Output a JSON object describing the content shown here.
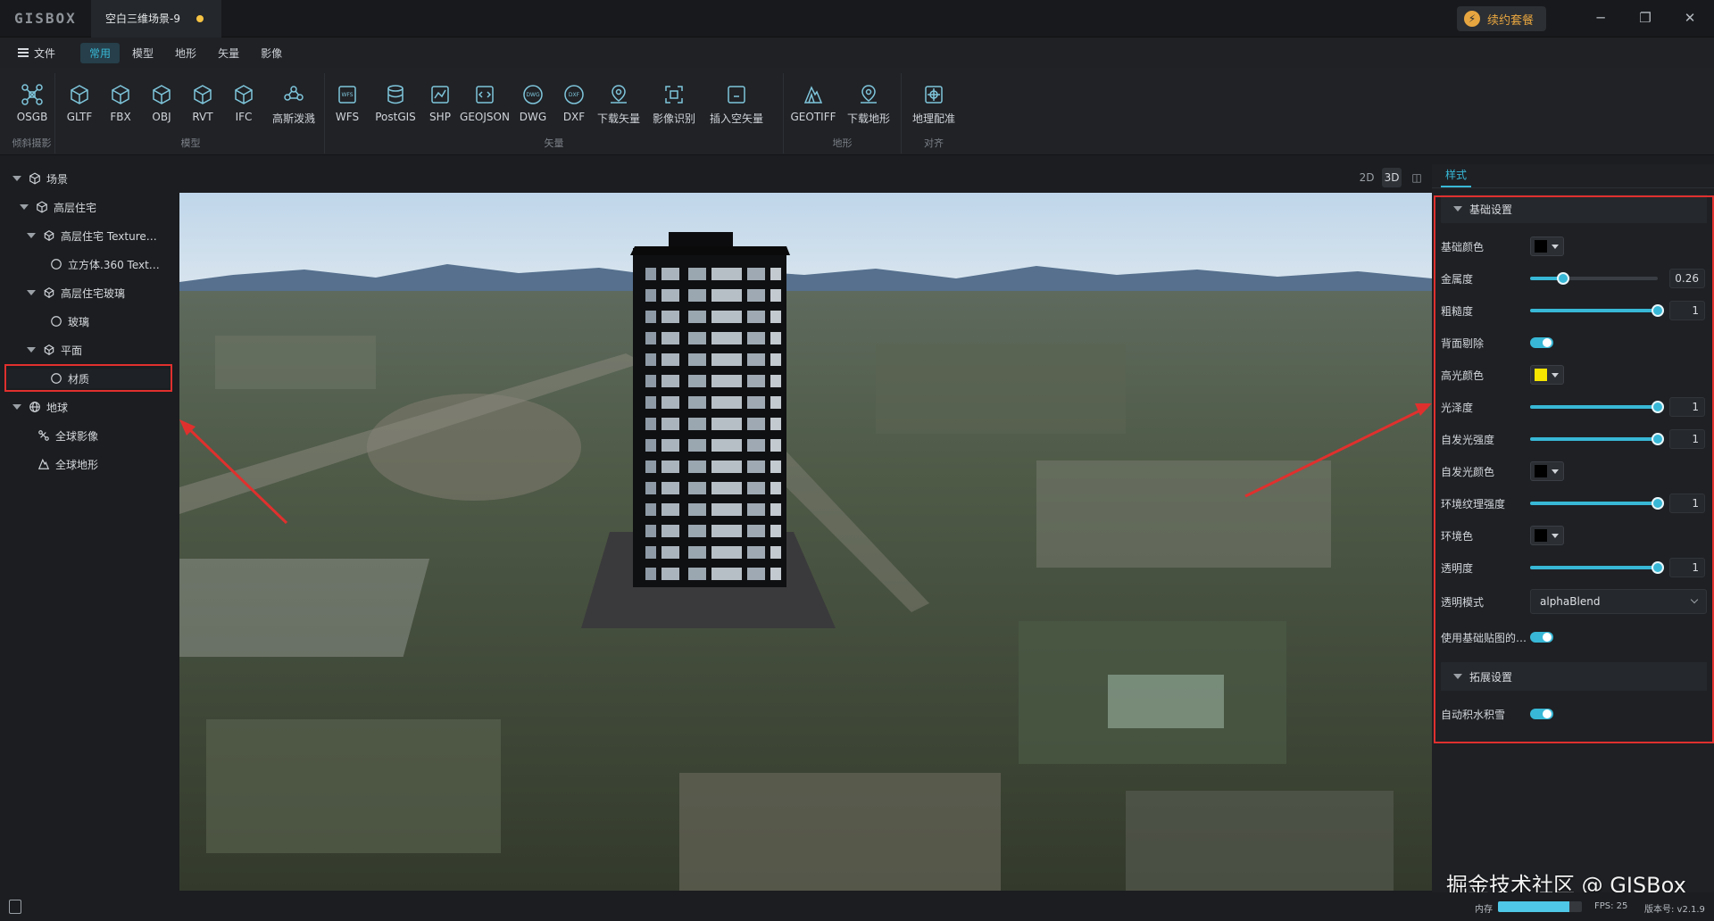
{
  "app": {
    "logo": "GISBOX",
    "doc_title": "空白三维场景-9",
    "renew_label": "续约套餐"
  },
  "window_buttons": {
    "minimize": "─",
    "restore": "❐",
    "close": "✕"
  },
  "menu": {
    "file": "文件",
    "tabs": [
      "常用",
      "模型",
      "地形",
      "矢量",
      "影像"
    ],
    "active_tab": "常用"
  },
  "ribbon": {
    "groups": [
      {
        "title": "倾斜摄影",
        "tools": [
          "OSGB"
        ]
      },
      {
        "title": "模型",
        "tools": [
          "GLTF",
          "FBX",
          "OBJ",
          "RVT",
          "IFC",
          "高斯泼溅"
        ]
      },
      {
        "title": "矢量",
        "tools": [
          "WFS",
          "PostGIS",
          "SHP",
          "GEOJSON",
          "DWG",
          "DXF",
          "下载矢量",
          "影像识别",
          "插入空矢量"
        ]
      },
      {
        "title": "地形",
        "tools": [
          "GEOTIFF",
          "下载地形"
        ]
      },
      {
        "title": "对齐",
        "tools": [
          "地理配准"
        ]
      }
    ]
  },
  "tree": {
    "scene": "场景",
    "building": "高层住宅",
    "building_texture": "高层住宅 Texture…",
    "cube": "立方体.360 Text…",
    "glass_group": "高层住宅玻璃",
    "glass": "玻璃",
    "plane": "平面",
    "material": "材质",
    "earth": "地球",
    "global_imagery": "全球影像",
    "global_terrain": "全球地形"
  },
  "view_modes": [
    "2D",
    "3D",
    "◫"
  ],
  "style_panel": {
    "tab": "样式",
    "basic_section": "基础设置",
    "ext_section": "拓展设置",
    "base_color": {
      "label": "基础颜色",
      "color": "#000000"
    },
    "metalness": {
      "label": "金属度",
      "value": "0.26",
      "fraction": 0.26
    },
    "roughness": {
      "label": "粗糙度",
      "value": "1",
      "fraction": 1
    },
    "backface": {
      "label": "背面剔除",
      "on": true
    },
    "specular_color": {
      "label": "高光颜色",
      "color": "#f5e400"
    },
    "glossiness": {
      "label": "光泽度",
      "value": "1",
      "fraction": 1
    },
    "emissive_intensity": {
      "label": "自发光强度",
      "value": "1",
      "fraction": 1
    },
    "emissive_color": {
      "label": "自发光颜色",
      "color": "#000000"
    },
    "env_texture_intensity": {
      "label": "环境纹理强度",
      "value": "1",
      "fraction": 1
    },
    "env_color": {
      "label": "环境色",
      "color": "#000000"
    },
    "opacity": {
      "label": "透明度",
      "value": "1",
      "fraction": 1
    },
    "alpha_mode": {
      "label": "透明模式",
      "value": "alphaBlend"
    },
    "use_base_map": {
      "label": "使用基础贴图的…",
      "on": true
    },
    "auto_water": {
      "label": "自动积水积雪",
      "on": true
    }
  },
  "watermark": "掘金技术社区 @ GISBox",
  "status": {
    "memory_label": "内存",
    "memory_fraction": 0.85,
    "fps": "FPS: 25",
    "version": "版本号: v2.1.9"
  },
  "colors": {
    "accent": "#38b8d6",
    "highlight_box": "#e0302e"
  }
}
